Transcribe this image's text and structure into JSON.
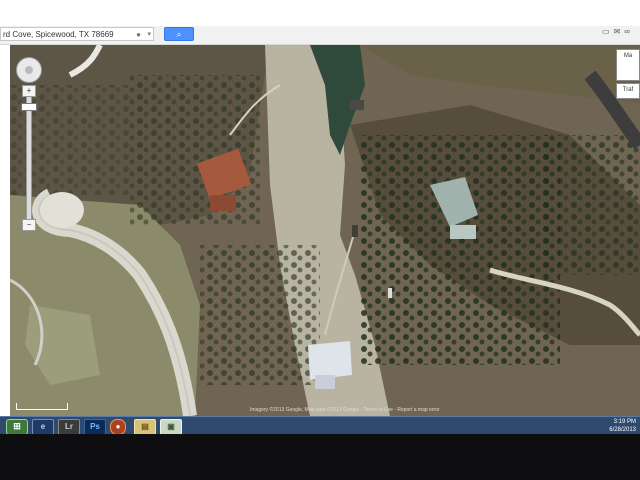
{
  "search": {
    "address_text": "rd Cove, Spicewood, TX 78669",
    "mic_icon": "microphone-icon",
    "search_button_icon": "search-icon"
  },
  "toolbar_icons": [
    "print-icon",
    "mail-icon",
    "link-icon"
  ],
  "map": {
    "type": "satellite",
    "controls": {
      "pan_icon": "pan-compass-icon",
      "zoom_in_label": "+",
      "zoom_out_label": "−",
      "maptype_label": "Ma",
      "traffic_label": "Traf"
    },
    "copyright_text": "Imagery ©2013 Google, Map data ©2013 Google · Terms of Use · Report a map error"
  },
  "taskbar": {
    "start_label": "⊞",
    "apps": [
      {
        "name": "ie-app-icon",
        "glyph": "e"
      },
      {
        "name": "lr-app-icon",
        "glyph": "Lr"
      },
      {
        "name": "ps-app-icon",
        "glyph": "Ps"
      },
      {
        "name": "firefox-app-icon",
        "glyph": "●"
      },
      {
        "name": "folder-app-icon",
        "glyph": "▤"
      },
      {
        "name": "notes-app-icon",
        "glyph": "▣"
      }
    ],
    "clock_time": "3:19 PM",
    "clock_date": "6/28/2013"
  },
  "colors": {
    "search_button": "#4d90fe",
    "taskbar": "#2f4a6e",
    "water": "#2f4a3a",
    "terrain": "#6e6450"
  }
}
